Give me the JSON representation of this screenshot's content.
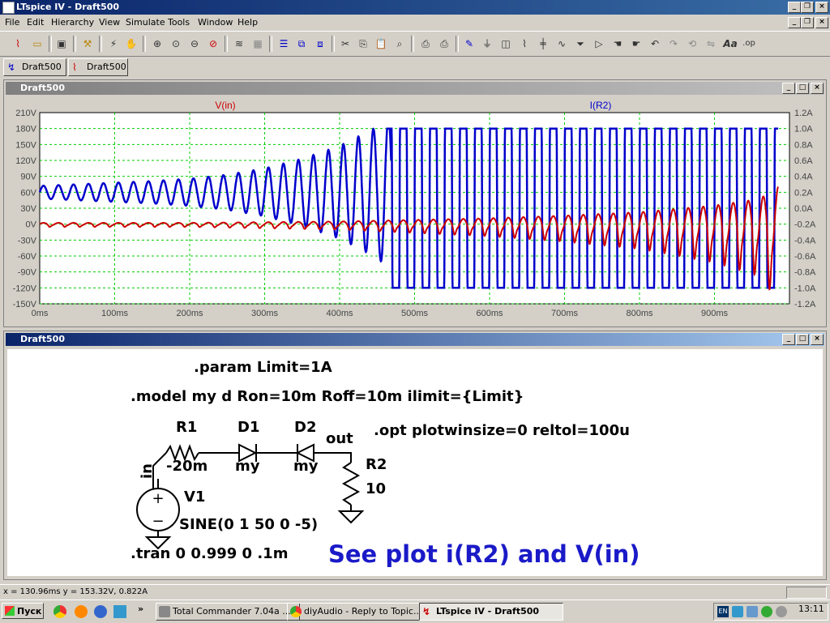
{
  "app": {
    "title": "LTspice IV - Draft500"
  },
  "menu": [
    "File",
    "Edit",
    "Hierarchy",
    "View",
    "Simulate",
    "Tools",
    "Window",
    "Help"
  ],
  "tabs": [
    {
      "label": "Draft500"
    },
    {
      "label": "Draft500"
    }
  ],
  "plot": {
    "window_title": "Draft500",
    "traces": [
      {
        "name": "V(in)",
        "color": "#cc0000"
      },
      {
        "name": "I(R2)",
        "color": "#0000cc"
      }
    ],
    "left_ticks": [
      "210V",
      "180V",
      "150V",
      "120V",
      "90V",
      "60V",
      "30V",
      "0V",
      "-30V",
      "-60V",
      "-90V",
      "-120V",
      "-150V"
    ],
    "right_ticks": [
      "1.2A",
      "1.0A",
      "0.8A",
      "0.6A",
      "0.4A",
      "0.2A",
      "0.0A",
      "-0.2A",
      "-0.4A",
      "-0.6A",
      "-0.8A",
      "-1.0A",
      "-1.2A"
    ],
    "x_ticks": [
      "0ms",
      "100ms",
      "200ms",
      "300ms",
      "400ms",
      "500ms",
      "600ms",
      "700ms",
      "800ms",
      "900ms"
    ],
    "grid_color": "#00cc00"
  },
  "chart_data": {
    "type": "line",
    "title": "",
    "xlabel": "",
    "ylabel": "",
    "xlim_ms": [
      0,
      1000
    ],
    "y_left_lim_V": [
      -150,
      210
    ],
    "y_right_lim_A": [
      -1.2,
      1.2
    ],
    "grid": true,
    "series": [
      {
        "name": "V(in)",
        "axis": "left",
        "frequency_hz": 50,
        "envelope_ms": [
          0,
          200,
          400,
          600,
          700,
          800,
          900,
          960,
          990
        ],
        "envelope_V": [
          5,
          5,
          10,
          22,
          32,
          45,
          70,
          95,
          150
        ]
      },
      {
        "name": "I(R2)",
        "axis": "right",
        "frequency_hz": 50,
        "points_ms": [
          0,
          50,
          100,
          150,
          200,
          250,
          300,
          350,
          400,
          450,
          470,
          500,
          600,
          700,
          800,
          900,
          980
        ],
        "amplitude_A": [
          0.08,
          0.1,
          0.12,
          0.14,
          0.17,
          0.22,
          0.3,
          0.42,
          0.58,
          0.82,
          1.0,
          1.0,
          1.0,
          1.0,
          1.0,
          1.0,
          1.0
        ]
      }
    ]
  },
  "schematic": {
    "window_title": "Draft500",
    "param": ".param Limit=1A",
    "model": ".model my d Ron=10m Roff=10m ilimit={Limit}",
    "opt": ".opt plotwinsize=0 reltol=100u",
    "tran": ".tran 0 0.999 0 .1m",
    "note": "See plot i(R2) and V(in)",
    "r1_name": "R1",
    "r1_value": "-20m",
    "d1_name": "D1",
    "d1_value": "my",
    "d2_name": "D2",
    "d2_value": "my",
    "r2_name": "R2",
    "r2_value": "10",
    "v1_name": "V1",
    "v1_value": "SINE(0 1 50 0 -5)",
    "net_in": "in",
    "net_out": "out",
    "plus": "+",
    "minus": "−"
  },
  "status": {
    "coords": "x = 130.96ms    y = 153.32V, 0.822A"
  },
  "taskbar": {
    "start": "Пуск",
    "chevron": "»",
    "tasks": [
      {
        "label": "Total Commander 7.04a ..."
      },
      {
        "label": "diyAudio - Reply to Topic..."
      },
      {
        "label": "LTspice IV - Draft500"
      }
    ],
    "lang": "EN",
    "clock": "13:11"
  }
}
